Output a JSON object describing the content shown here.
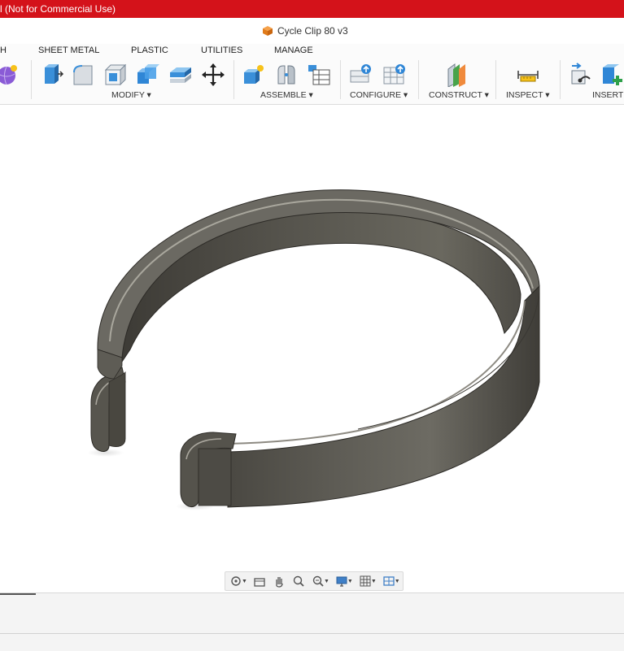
{
  "window": {
    "title_partial": "l (Not for Commercial Use)",
    "document_name": "Cycle Clip 80 v3",
    "document_icon": "orange-cube-icon",
    "accent_color": "#d4121a"
  },
  "ribbon": {
    "tabs": [
      "H",
      "SHEET METAL",
      "PLASTIC",
      "UTILITIES",
      "MANAGE"
    ],
    "groups": {
      "modify": "MODIFY ▾",
      "assemble": "ASSEMBLE ▾",
      "configure": "CONFIGURE ▾",
      "construct": "CONSTRUCT ▾",
      "inspect": "INSPECT ▾",
      "insert": "INSERT"
    },
    "tool_icons": [
      "sphere-icon",
      "press-pull-icon",
      "fillet-icon",
      "shell-icon",
      "combine-icon",
      "offset-face-icon",
      "move-icon",
      "new-component-icon",
      "joint-icon",
      "table-icon",
      "configure-insert-icon",
      "configure-table-icon",
      "offset-plane-icon",
      "measure-icon",
      "insert-derive-icon",
      "insert-mesh-icon"
    ]
  },
  "navbar": {
    "icons": [
      "orbit-icon",
      "look-at-icon",
      "pan-icon",
      "zoom-icon",
      "zoom-window-icon",
      "display-settings-icon",
      "grid-icon",
      "viewports-icon"
    ]
  }
}
